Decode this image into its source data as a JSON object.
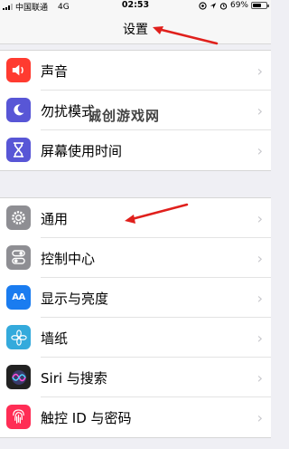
{
  "status_bar": {
    "carrier": "中国联通",
    "network": "4G",
    "time": "02:53",
    "battery_text": "69%",
    "battery_level": 0.69
  },
  "nav": {
    "title": "设置"
  },
  "groups": [
    {
      "items": [
        {
          "label": "声音",
          "icon": "speaker-icon",
          "color": "#ff3b30"
        },
        {
          "label": "勿扰模式",
          "icon": "moon-icon",
          "color": "#5856d6"
        },
        {
          "label": "屏幕使用时间",
          "icon": "hourglass-icon",
          "color": "#5856d6"
        }
      ]
    },
    {
      "items": [
        {
          "label": "通用",
          "icon": "gear-icon",
          "color": "#8e8e93"
        },
        {
          "label": "控制中心",
          "icon": "toggles-icon",
          "color": "#8e8e93"
        },
        {
          "label": "显示与亮度",
          "icon": "aa-icon",
          "icon_text": "AA",
          "color": "#1a7cf0"
        },
        {
          "label": "墙纸",
          "icon": "flower-icon",
          "color": "#34aadc"
        },
        {
          "label": "Siri 与搜索",
          "icon": "siri-icon",
          "color": "#222222"
        },
        {
          "label": "触控 ID 与密码",
          "icon": "fingerprint-icon",
          "color": "#ff2d55"
        }
      ]
    }
  ],
  "watermark": "诚创游戏网",
  "accent_arrow_color": "#e0201c"
}
